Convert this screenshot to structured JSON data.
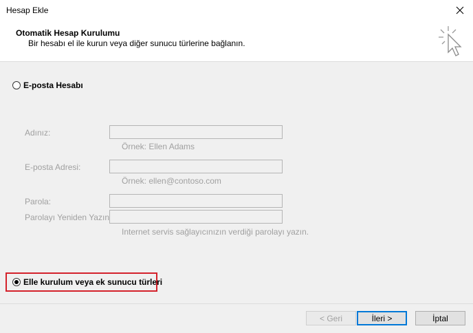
{
  "window": {
    "title": "Hesap Ekle",
    "close_icon": "close-icon"
  },
  "header": {
    "title": "Otomatik Hesap Kurulumu",
    "subtitle": "Bir hesabı el ile kurun veya diğer sunucu türlerine bağlanın.",
    "icon": "wizard-cursor-icon"
  },
  "options": {
    "email_account_label": "E-posta Hesabı",
    "manual_setup_label": "Elle kurulum veya ek sunucu türleri",
    "selected": "manual_setup"
  },
  "form": {
    "name_label": "Adınız:",
    "name_value": "",
    "name_hint": "Örnek: Ellen Adams",
    "email_label": "E-posta Adresi:",
    "email_value": "",
    "email_hint": "Örnek: ellen@contoso.com",
    "password_label": "Parola:",
    "password_value": "",
    "password_confirm_label": "Parolayı Yeniden Yazın:",
    "password_confirm_value": "",
    "password_hint": "Internet servis sağlayıcınızın verdiği parolayı yazın."
  },
  "buttons": {
    "back_label": "< Geri",
    "next_label": "İleri >",
    "cancel_label": "İptal"
  },
  "colors": {
    "highlight": "#d4202a",
    "default_button_border": "#0078d7"
  }
}
